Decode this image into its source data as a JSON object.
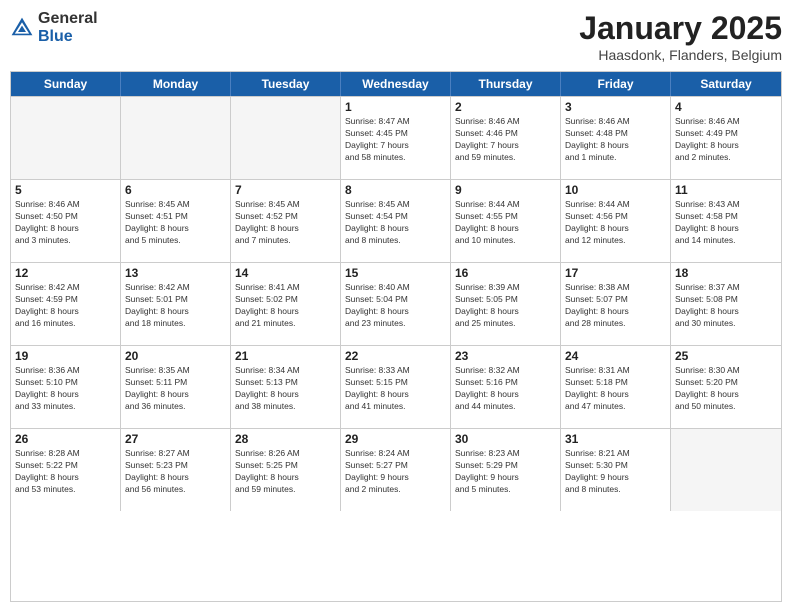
{
  "header": {
    "logo_general": "General",
    "logo_blue": "Blue",
    "month_title": "January 2025",
    "location": "Haasdonk, Flanders, Belgium"
  },
  "days_of_week": [
    "Sunday",
    "Monday",
    "Tuesday",
    "Wednesday",
    "Thursday",
    "Friday",
    "Saturday"
  ],
  "weeks": [
    [
      {
        "day": "",
        "content": ""
      },
      {
        "day": "",
        "content": ""
      },
      {
        "day": "",
        "content": ""
      },
      {
        "day": "1",
        "content": "Sunrise: 8:47 AM\nSunset: 4:45 PM\nDaylight: 7 hours\nand 58 minutes."
      },
      {
        "day": "2",
        "content": "Sunrise: 8:46 AM\nSunset: 4:46 PM\nDaylight: 7 hours\nand 59 minutes."
      },
      {
        "day": "3",
        "content": "Sunrise: 8:46 AM\nSunset: 4:48 PM\nDaylight: 8 hours\nand 1 minute."
      },
      {
        "day": "4",
        "content": "Sunrise: 8:46 AM\nSunset: 4:49 PM\nDaylight: 8 hours\nand 2 minutes."
      }
    ],
    [
      {
        "day": "5",
        "content": "Sunrise: 8:46 AM\nSunset: 4:50 PM\nDaylight: 8 hours\nand 3 minutes."
      },
      {
        "day": "6",
        "content": "Sunrise: 8:45 AM\nSunset: 4:51 PM\nDaylight: 8 hours\nand 5 minutes."
      },
      {
        "day": "7",
        "content": "Sunrise: 8:45 AM\nSunset: 4:52 PM\nDaylight: 8 hours\nand 7 minutes."
      },
      {
        "day": "8",
        "content": "Sunrise: 8:45 AM\nSunset: 4:54 PM\nDaylight: 8 hours\nand 8 minutes."
      },
      {
        "day": "9",
        "content": "Sunrise: 8:44 AM\nSunset: 4:55 PM\nDaylight: 8 hours\nand 10 minutes."
      },
      {
        "day": "10",
        "content": "Sunrise: 8:44 AM\nSunset: 4:56 PM\nDaylight: 8 hours\nand 12 minutes."
      },
      {
        "day": "11",
        "content": "Sunrise: 8:43 AM\nSunset: 4:58 PM\nDaylight: 8 hours\nand 14 minutes."
      }
    ],
    [
      {
        "day": "12",
        "content": "Sunrise: 8:42 AM\nSunset: 4:59 PM\nDaylight: 8 hours\nand 16 minutes."
      },
      {
        "day": "13",
        "content": "Sunrise: 8:42 AM\nSunset: 5:01 PM\nDaylight: 8 hours\nand 18 minutes."
      },
      {
        "day": "14",
        "content": "Sunrise: 8:41 AM\nSunset: 5:02 PM\nDaylight: 8 hours\nand 21 minutes."
      },
      {
        "day": "15",
        "content": "Sunrise: 8:40 AM\nSunset: 5:04 PM\nDaylight: 8 hours\nand 23 minutes."
      },
      {
        "day": "16",
        "content": "Sunrise: 8:39 AM\nSunset: 5:05 PM\nDaylight: 8 hours\nand 25 minutes."
      },
      {
        "day": "17",
        "content": "Sunrise: 8:38 AM\nSunset: 5:07 PM\nDaylight: 8 hours\nand 28 minutes."
      },
      {
        "day": "18",
        "content": "Sunrise: 8:37 AM\nSunset: 5:08 PM\nDaylight: 8 hours\nand 30 minutes."
      }
    ],
    [
      {
        "day": "19",
        "content": "Sunrise: 8:36 AM\nSunset: 5:10 PM\nDaylight: 8 hours\nand 33 minutes."
      },
      {
        "day": "20",
        "content": "Sunrise: 8:35 AM\nSunset: 5:11 PM\nDaylight: 8 hours\nand 36 minutes."
      },
      {
        "day": "21",
        "content": "Sunrise: 8:34 AM\nSunset: 5:13 PM\nDaylight: 8 hours\nand 38 minutes."
      },
      {
        "day": "22",
        "content": "Sunrise: 8:33 AM\nSunset: 5:15 PM\nDaylight: 8 hours\nand 41 minutes."
      },
      {
        "day": "23",
        "content": "Sunrise: 8:32 AM\nSunset: 5:16 PM\nDaylight: 8 hours\nand 44 minutes."
      },
      {
        "day": "24",
        "content": "Sunrise: 8:31 AM\nSunset: 5:18 PM\nDaylight: 8 hours\nand 47 minutes."
      },
      {
        "day": "25",
        "content": "Sunrise: 8:30 AM\nSunset: 5:20 PM\nDaylight: 8 hours\nand 50 minutes."
      }
    ],
    [
      {
        "day": "26",
        "content": "Sunrise: 8:28 AM\nSunset: 5:22 PM\nDaylight: 8 hours\nand 53 minutes."
      },
      {
        "day": "27",
        "content": "Sunrise: 8:27 AM\nSunset: 5:23 PM\nDaylight: 8 hours\nand 56 minutes."
      },
      {
        "day": "28",
        "content": "Sunrise: 8:26 AM\nSunset: 5:25 PM\nDaylight: 8 hours\nand 59 minutes."
      },
      {
        "day": "29",
        "content": "Sunrise: 8:24 AM\nSunset: 5:27 PM\nDaylight: 9 hours\nand 2 minutes."
      },
      {
        "day": "30",
        "content": "Sunrise: 8:23 AM\nSunset: 5:29 PM\nDaylight: 9 hours\nand 5 minutes."
      },
      {
        "day": "31",
        "content": "Sunrise: 8:21 AM\nSunset: 5:30 PM\nDaylight: 9 hours\nand 8 minutes."
      },
      {
        "day": "",
        "content": ""
      }
    ]
  ]
}
